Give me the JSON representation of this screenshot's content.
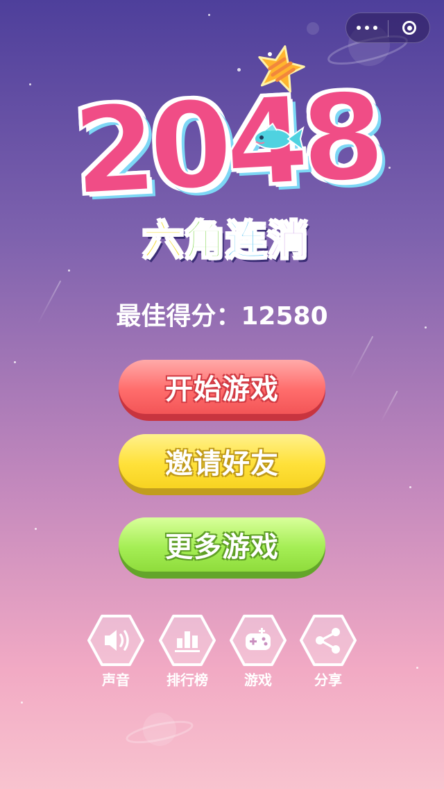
{
  "capsule": {
    "more_icon": "more-dots-icon",
    "close_icon": "close-circle-icon"
  },
  "logo": {
    "number": "2048",
    "subtitle_chars": [
      "六",
      "角",
      "连",
      "消"
    ],
    "subtitle_colors": [
      "#f3dc3b",
      "#7fd64a",
      "#5cc3f2",
      "#c99be6"
    ],
    "star_icon": "star-icon",
    "fish_icon": "fish-icon"
  },
  "best_score": {
    "label": "最佳得分：",
    "value": "12580"
  },
  "buttons": {
    "start": "开始游戏",
    "invite": "邀请好友",
    "more": "更多游戏"
  },
  "icon_buttons": [
    {
      "label": "声音",
      "icon": "speaker-icon"
    },
    {
      "label": "排行榜",
      "icon": "bar-chart-icon"
    },
    {
      "label": "游戏",
      "icon": "gamepad-icon"
    },
    {
      "label": "分享",
      "icon": "share-icon"
    }
  ],
  "colors": {
    "bg_top": "#4e3f9b",
    "bg_bottom": "#f8c3cf",
    "start_button": "#ff6d6c",
    "invite_button": "#ffe13a",
    "more_button": "#a5ee55",
    "logo_pink": "#f04d86"
  }
}
